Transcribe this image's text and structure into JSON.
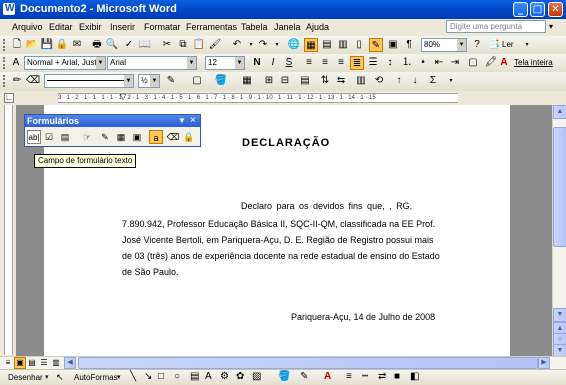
{
  "window": {
    "title": "Documento2 - Microsoft Word"
  },
  "menu": [
    "Arquivo",
    "Editar",
    "Exibir",
    "Inserir",
    "Formatar",
    "Ferramentas",
    "Tabela",
    "Janela",
    "Ajuda"
  ],
  "ask_placeholder": "Digite uma pergunta",
  "standard_toolbar": {
    "zoom": "80%",
    "read_label": "Ler"
  },
  "format_toolbar": {
    "style": "Normal + Arial, Justi",
    "font": "Arial",
    "size": "12",
    "full_screen_label": "Tela inteira"
  },
  "forms_toolbar": {
    "title": "Formulários",
    "tooltip": "Campo de formulário texto",
    "text_field_icon_label": "ab|"
  },
  "document": {
    "heading": "DECLARAÇÃO",
    "lines": [
      "Declaro  para  os  devidos  fins  que,      ,  RG.",
      "7.890.942, Professor Educação Básica II, SQC-II-QM, classificada na EE Prof.",
      "José Vicente Bertoli, em Pariquera-Açu, D. E. Região de Registro possui mais",
      "de 03 (três) anos de experiência docente na rede estadual de ensino do Estado",
      "de São Paulo."
    ],
    "signature_line": "Pariquera-Açu, 14 de Julho de 2008"
  },
  "ruler_text": "3 · 1 · 2 · 1 · 1 · 1 · 1 · 1 · 2 · 1 · 3 · 1 · 4 · 1 · 5 · 1 · 6 · 1 · 7 · 1 · 8 · 1 · 9 · 1 · 10 · 1 · 11 · 1 · 12 · 1 · 13 · 1 · 14 · 1 · 15",
  "drawing_toolbar": {
    "draw_label": "Desenhar",
    "autoshapes_label": "AutoFormas"
  },
  "colors": {
    "titlebar": "#0046c8",
    "highlight": "#ffc45c"
  }
}
